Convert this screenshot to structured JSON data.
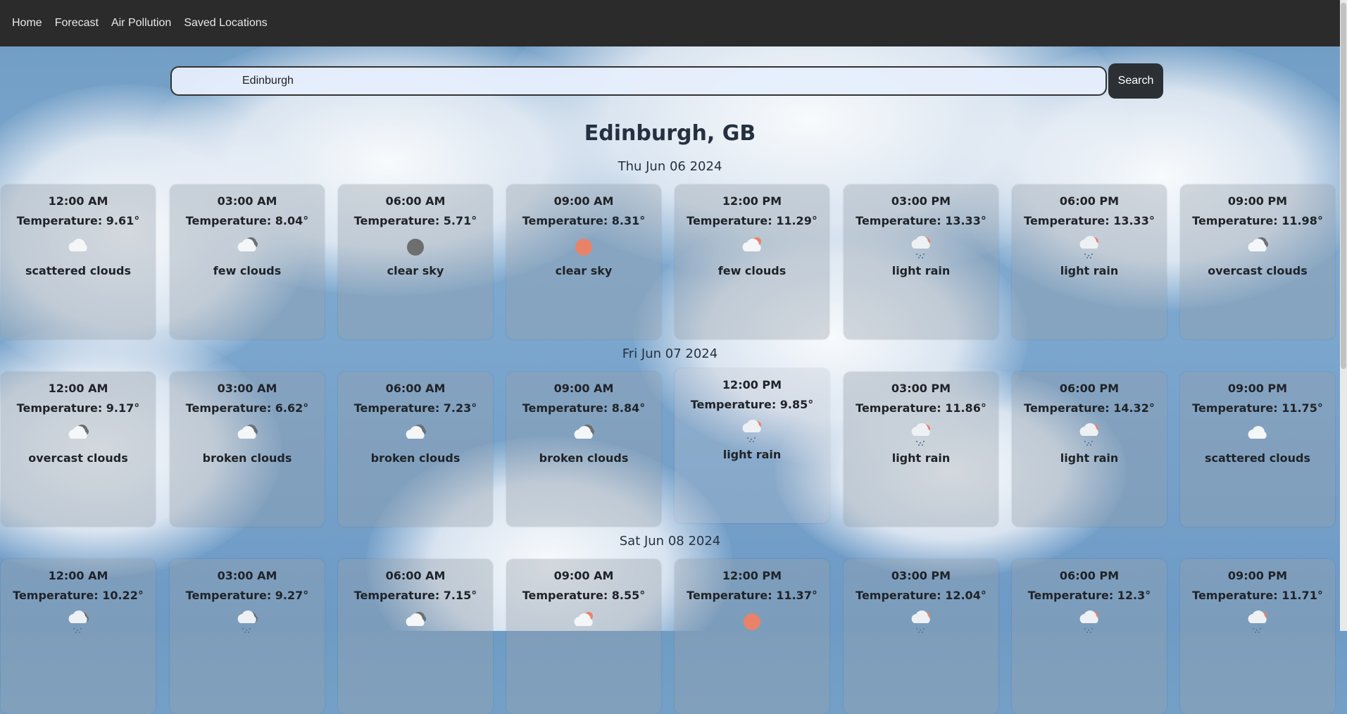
{
  "nav": {
    "items": [
      "Home",
      "Forecast",
      "Air Pollution",
      "Saved Locations"
    ]
  },
  "search": {
    "value": "Edinburgh",
    "button_label": "Search"
  },
  "location": {
    "title": "Edinburgh, GB"
  },
  "days": [
    {
      "label": "Thu Jun 06 2024",
      "entries": [
        {
          "time": "12:00 AM",
          "temp": "Temperature: 9.61°",
          "icon": "cloud",
          "desc": "scattered clouds"
        },
        {
          "time": "03:00 AM",
          "temp": "Temperature: 8.04°",
          "icon": "cloud-dark",
          "desc": "few clouds"
        },
        {
          "time": "06:00 AM",
          "temp": "Temperature: 5.71°",
          "icon": "moon",
          "desc": "clear sky"
        },
        {
          "time": "09:00 AM",
          "temp": "Temperature: 8.31°",
          "icon": "sun",
          "desc": "clear sky"
        },
        {
          "time": "12:00 PM",
          "temp": "Temperature: 11.29°",
          "icon": "sun-cloud",
          "desc": "few clouds"
        },
        {
          "time": "03:00 PM",
          "temp": "Temperature: 13.33°",
          "icon": "rain",
          "desc": "light rain"
        },
        {
          "time": "06:00 PM",
          "temp": "Temperature: 13.33°",
          "icon": "rain",
          "desc": "light rain"
        },
        {
          "time": "09:00 PM",
          "temp": "Temperature: 11.98°",
          "icon": "overcast",
          "desc": "overcast clouds"
        }
      ]
    },
    {
      "label": "Fri Jun 07 2024",
      "entries": [
        {
          "time": "12:00 AM",
          "temp": "Temperature: 9.17°",
          "icon": "overcast",
          "desc": "overcast clouds"
        },
        {
          "time": "03:00 AM",
          "temp": "Temperature: 6.62°",
          "icon": "overcast",
          "desc": "broken clouds"
        },
        {
          "time": "06:00 AM",
          "temp": "Temperature: 7.23°",
          "icon": "overcast",
          "desc": "broken clouds"
        },
        {
          "time": "09:00 AM",
          "temp": "Temperature: 8.84°",
          "icon": "overcast",
          "desc": "broken clouds"
        },
        {
          "time": "12:00 PM",
          "temp": "Temperature: 9.85°",
          "icon": "rain",
          "desc": "light rain"
        },
        {
          "time": "03:00 PM",
          "temp": "Temperature: 11.86°",
          "icon": "rain",
          "desc": "light rain"
        },
        {
          "time": "06:00 PM",
          "temp": "Temperature: 14.32°",
          "icon": "rain",
          "desc": "light rain"
        },
        {
          "time": "09:00 PM",
          "temp": "Temperature: 11.75°",
          "icon": "cloud",
          "desc": "scattered clouds"
        }
      ]
    },
    {
      "label": "Sat Jun 08 2024",
      "entries": [
        {
          "time": "12:00 AM",
          "temp": "Temperature: 10.22°",
          "icon": "rain-night",
          "desc": ""
        },
        {
          "time": "03:00 AM",
          "temp": "Temperature: 9.27°",
          "icon": "rain-night",
          "desc": ""
        },
        {
          "time": "06:00 AM",
          "temp": "Temperature: 7.15°",
          "icon": "overcast",
          "desc": ""
        },
        {
          "time": "09:00 AM",
          "temp": "Temperature: 8.55°",
          "icon": "sun-cloud",
          "desc": ""
        },
        {
          "time": "12:00 PM",
          "temp": "Temperature: 11.37°",
          "icon": "sun",
          "desc": ""
        },
        {
          "time": "03:00 PM",
          "temp": "Temperature: 12.04°",
          "icon": "rain",
          "desc": ""
        },
        {
          "time": "06:00 PM",
          "temp": "Temperature: 12.3°",
          "icon": "rain",
          "desc": ""
        },
        {
          "time": "09:00 PM",
          "temp": "Temperature: 11.71°",
          "icon": "rain",
          "desc": ""
        }
      ]
    }
  ],
  "colors": {
    "navbar": "#2b2b2b",
    "sun": "#e8836a",
    "moon": "#6e6e6e",
    "button": "#2c3034"
  }
}
